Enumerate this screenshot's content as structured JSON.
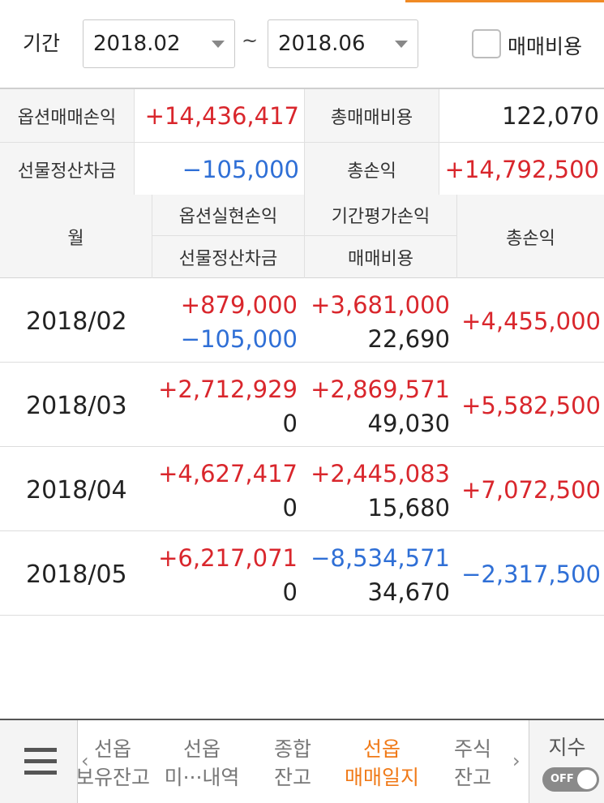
{
  "filter": {
    "period_label": "기간",
    "from": "2018.02",
    "separator": "~",
    "to": "2018.06",
    "include_fee_label": "매매비용",
    "include_fee_checked": false
  },
  "summary": {
    "option_pl_label": "옵션매매손익",
    "option_pl_value": "+14,436,417",
    "total_fee_label": "총매매비용",
    "total_fee_value": "122,070",
    "futures_settle_label": "선물정산차금",
    "futures_settle_value": "−105,000",
    "total_pl_label": "총손익",
    "total_pl_value": "+14,792,500"
  },
  "table": {
    "headers": {
      "month": "월",
      "option_realized": "옵션실현손익",
      "futures_settle": "선물정산차금",
      "period_eval": "기간평가손익",
      "fee": "매매비용",
      "total": "총손익"
    },
    "rows": [
      {
        "month": "2018/02",
        "option_realized": "+879,000",
        "futures_settle": "−105,000",
        "period_eval": "+3,681,000",
        "fee": "22,690",
        "total": "+4,455,000"
      },
      {
        "month": "2018/03",
        "option_realized": "+2,712,929",
        "futures_settle": "0",
        "period_eval": "+2,869,571",
        "fee": "49,030",
        "total": "+5,582,500"
      },
      {
        "month": "2018/04",
        "option_realized": "+4,627,417",
        "futures_settle": "0",
        "period_eval": "+2,445,083",
        "fee": "15,680",
        "total": "+7,072,500"
      },
      {
        "month": "2018/05",
        "option_realized": "+6,217,071",
        "futures_settle": "0",
        "period_eval": "−8,534,571",
        "fee": "34,670",
        "total": "−2,317,500"
      }
    ]
  },
  "bottom_nav": {
    "tabs": [
      {
        "line1": "선옵",
        "line2": "보유잔고"
      },
      {
        "line1": "선옵",
        "line2": "미···내역"
      },
      {
        "line1": "종합",
        "line2": "잔고"
      },
      {
        "line1": "선옵",
        "line2": "매매일지"
      },
      {
        "line1": "주식",
        "line2": "잔고"
      }
    ],
    "active_tab": 3,
    "left_arrow": "‹",
    "right_arrow": "›",
    "index_label": "지수",
    "index_toggle": "OFF"
  },
  "colors": {
    "positive": "#d9262c",
    "negative": "#2f6fd6",
    "accent": "#f07a18"
  },
  "icons": [
    "hamburger-menu-icon",
    "dropdown-caret-icon",
    "chevron-left-icon",
    "chevron-right-icon"
  ]
}
